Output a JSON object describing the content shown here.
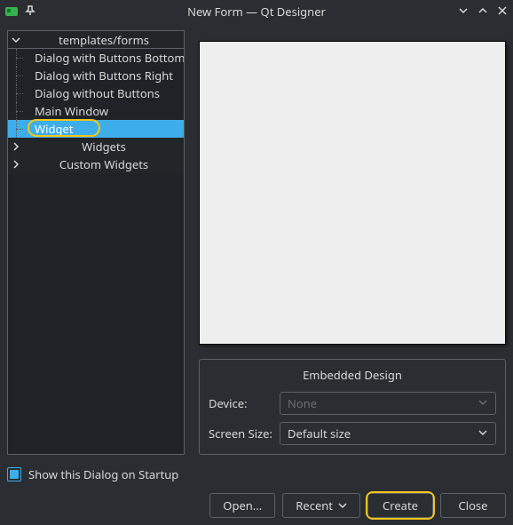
{
  "window": {
    "title": "New Form — Qt Designer"
  },
  "tree": {
    "root_label": "templates/forms",
    "items": [
      "Dialog with Buttons Bottom",
      "Dialog with Buttons Right",
      "Dialog without Buttons",
      "Main Window",
      "Widget"
    ],
    "selected_index": 4,
    "categories": [
      "Widgets",
      "Custom Widgets"
    ]
  },
  "embedded": {
    "group_title": "Embedded Design",
    "device_label": "Device:",
    "device_value": "None",
    "screen_label": "Screen Size:",
    "screen_value": "Default size"
  },
  "startup": {
    "label": "Show this Dialog on Startup",
    "checked": true
  },
  "buttons": {
    "open": "Open...",
    "recent": "Recent",
    "create": "Create",
    "close": "Close"
  },
  "highlight": {
    "create_button": true,
    "widget_item": true
  }
}
